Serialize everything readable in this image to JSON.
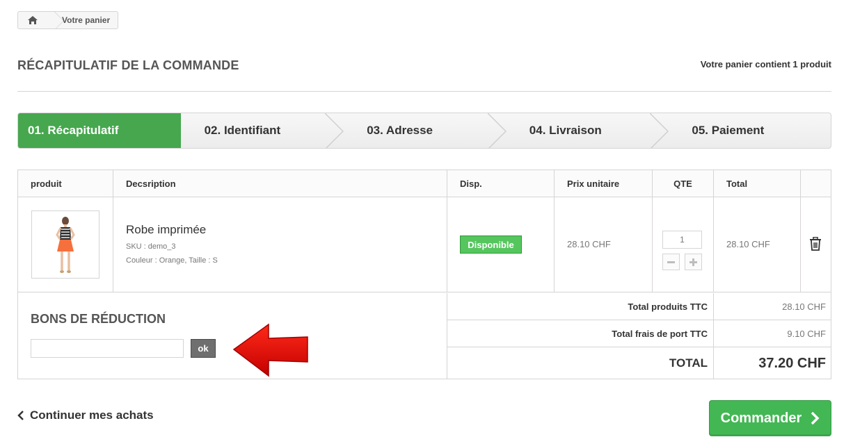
{
  "breadcrumb": {
    "current": "Votre panier"
  },
  "header": {
    "title": "RÉCAPITULATIF DE LA COMMANDE",
    "cart_count": "Votre panier contient 1 produit"
  },
  "steps": [
    {
      "label": "01. Récapitulatif",
      "active": true
    },
    {
      "label": "02. Identifiant",
      "active": false
    },
    {
      "label": "03. Adresse",
      "active": false
    },
    {
      "label": "04. Livraison",
      "active": false
    },
    {
      "label": "05. Paiement",
      "active": false
    }
  ],
  "table": {
    "headers": [
      "produit",
      "Decsription",
      "Disp.",
      "Prix unitaire",
      "QTE",
      "Total"
    ],
    "item": {
      "name": "Robe imprimée",
      "sku": "SKU : demo_3",
      "attributes": "Couleur : Orange, Taille : S",
      "availability": "Disponible",
      "unit_price": "28.10 CHF",
      "quantity": "1",
      "total": "28.10 CHF"
    }
  },
  "voucher": {
    "title": "BONS DE RÉDUCTION",
    "input_value": "",
    "button": "ok"
  },
  "totals": {
    "products_label": "Total produits TTC",
    "products_value": "28.10 CHF",
    "shipping_label": "Total frais de port TTC",
    "shipping_value": "9.10 CHF",
    "total_label": "TOTAL",
    "total_value": "37.20 CHF"
  },
  "footer": {
    "continue": "Continuer mes achats",
    "order": "Commander"
  },
  "colors": {
    "success": "#46a74e",
    "badge": "#55c65e",
    "arrow": "#e00000",
    "order_button": "#43b754"
  },
  "icons": [
    "home-icon",
    "trash-icon",
    "minus-icon",
    "plus-icon",
    "chevron-left-icon",
    "chevron-right-icon",
    "red-arrow-icon"
  ]
}
